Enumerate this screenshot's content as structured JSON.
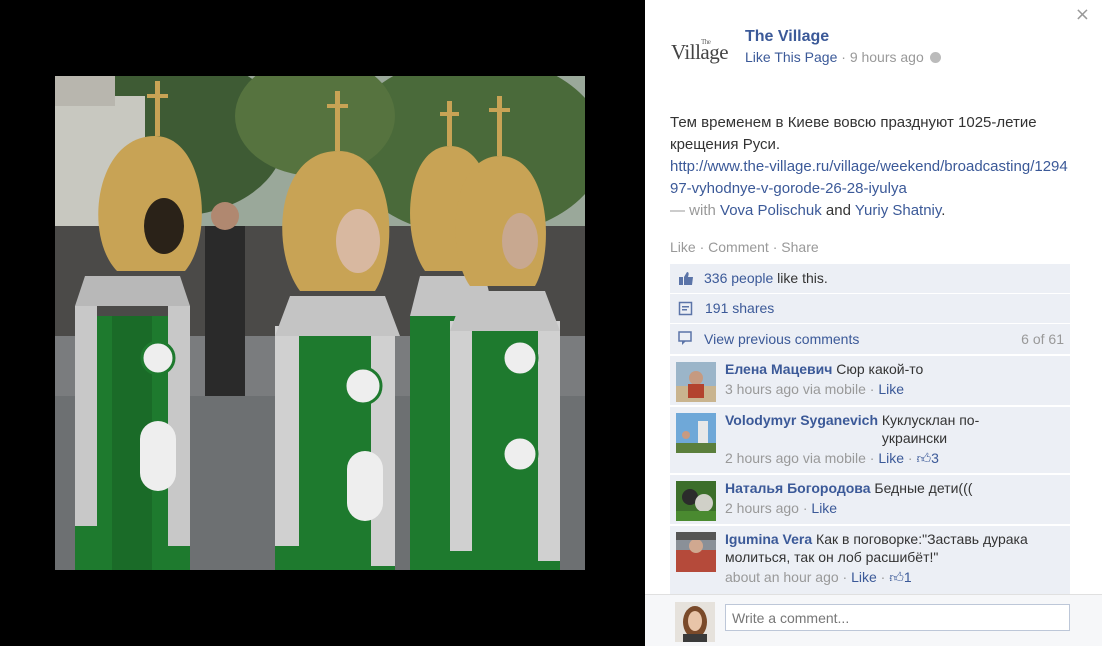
{
  "close_label": "×",
  "page": {
    "logo_text": "Village",
    "logo_small": "The",
    "name": "The Village",
    "like_page": "Like This Page",
    "separator": " · ",
    "time": "9 hours ago"
  },
  "post": {
    "text": "Тем временем в Киеве вовсю празднуют 1025-летие крещения Руси.",
    "link": "http://www.the-village.ru/village/weekend/broadcasting/129497-vyhodnye-v-gorode-26-28-iyulya",
    "with_prefix": "— with ",
    "tagged_1": "Vova Polischuk",
    "and": " and ",
    "tagged_2": "Yuriy Shatniy",
    "period": "."
  },
  "actions": {
    "like": "Like",
    "comment": "Comment",
    "share": "Share"
  },
  "stats": {
    "likes_link": "336 people",
    "likes_text": " like this.",
    "shares": "191 shares",
    "view_previous": "View previous comments",
    "count": "6 of 61"
  },
  "comments": [
    {
      "author": "Елена Мацевич",
      "text": "Сюр какой-то",
      "time": "3 hours ago via mobile",
      "like": "Like",
      "likes": ""
    },
    {
      "author": "Volodymyr Syganevich",
      "text": "Куклусклан по-украински",
      "time": "2 hours ago via mobile",
      "like": "Like",
      "likes": "3"
    },
    {
      "author": "Наталья Богородова",
      "text": "Бедные дети(((",
      "time": "2 hours ago",
      "like": "Like",
      "likes": ""
    },
    {
      "author": "Igumina Vera",
      "text": "Как в поговорке:\"Заставь дурака молиться, так он лоб расшибёт!\"",
      "time": "about an hour ago",
      "like": "Like",
      "likes": "1"
    }
  ],
  "composer": {
    "placeholder": "Write a comment..."
  },
  "colors": {
    "link": "#3b5998",
    "bar_bg": "#eceff5",
    "muted": "#999999",
    "costume_green": "#1e7a2e",
    "costume_gold": "#c8a355"
  },
  "icons": [
    "close-icon",
    "globe-icon",
    "thumbs-up-icon",
    "share-icon",
    "comments-icon"
  ]
}
